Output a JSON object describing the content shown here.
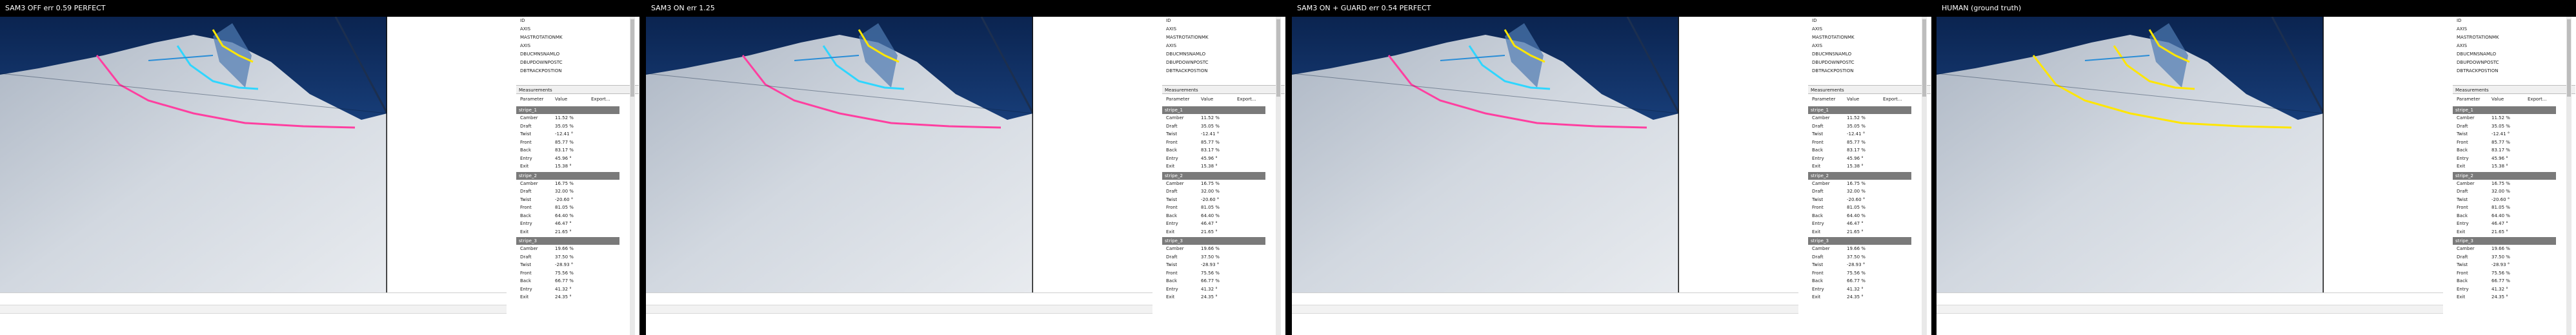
{
  "panels": [
    {
      "title": "SAM3 OFF err 0.59 PERFECT",
      "overlay": "pink"
    },
    {
      "title": "SAM3 ON err 1.25",
      "overlay": "pink"
    },
    {
      "title": "SAM3 ON + GUARD err 0.54 PERFECT",
      "overlay": "pink"
    },
    {
      "title": "HUMAN (ground truth)",
      "overlay": "yellow"
    }
  ],
  "layers": [
    "ID",
    "AXIS",
    "MASTROTATIONMK",
    "AXIS",
    "DBUCMNSNAMLO",
    "DBUPDOWNPOSTC",
    "DBTRACKPOSTION"
  ],
  "measurements_title": "Measurements",
  "columns": {
    "parameter": "Parameter",
    "value": "Value",
    "export": "Export..."
  },
  "sections": [
    {
      "name": "stripe_1",
      "rows": [
        {
          "p": "Camber",
          "v": "11.52 %"
        },
        {
          "p": "Draft",
          "v": "35.05 %"
        },
        {
          "p": "Twist",
          "v": "-12.41 °"
        },
        {
          "p": "Front",
          "v": "85.77 %"
        },
        {
          "p": "Back",
          "v": "83.17 %"
        },
        {
          "p": "Entry",
          "v": "45.96 °"
        },
        {
          "p": "Exit",
          "v": "15.38 °"
        }
      ]
    },
    {
      "name": "stripe_2",
      "rows": [
        {
          "p": "Camber",
          "v": "16.75 %"
        },
        {
          "p": "Draft",
          "v": "32.00 %"
        },
        {
          "p": "Twist",
          "v": "-20.60 °"
        },
        {
          "p": "Front",
          "v": "81.05 %"
        },
        {
          "p": "Back",
          "v": "64.40 %"
        },
        {
          "p": "Entry",
          "v": "46.47 °"
        },
        {
          "p": "Exit",
          "v": "21.65 °"
        }
      ]
    },
    {
      "name": "stripe_3",
      "rows": [
        {
          "p": "Camber",
          "v": "19.66 %"
        },
        {
          "p": "Draft",
          "v": "37.50 %"
        },
        {
          "p": "Twist",
          "v": "-28.93 °"
        },
        {
          "p": "Front",
          "v": "75.56 %"
        },
        {
          "p": "Back",
          "v": "66.77 %"
        },
        {
          "p": "Entry",
          "v": "41.32 °"
        },
        {
          "p": "Exit",
          "v": "24.35 °"
        }
      ]
    }
  ],
  "colors": {
    "sky": "#0e2a56",
    "sail": "#c9d0d9",
    "pink": "#ff3fa0",
    "yellow": "#ffe600",
    "cyan": "#2fd6ff",
    "stripe": "#7a7a7a"
  }
}
